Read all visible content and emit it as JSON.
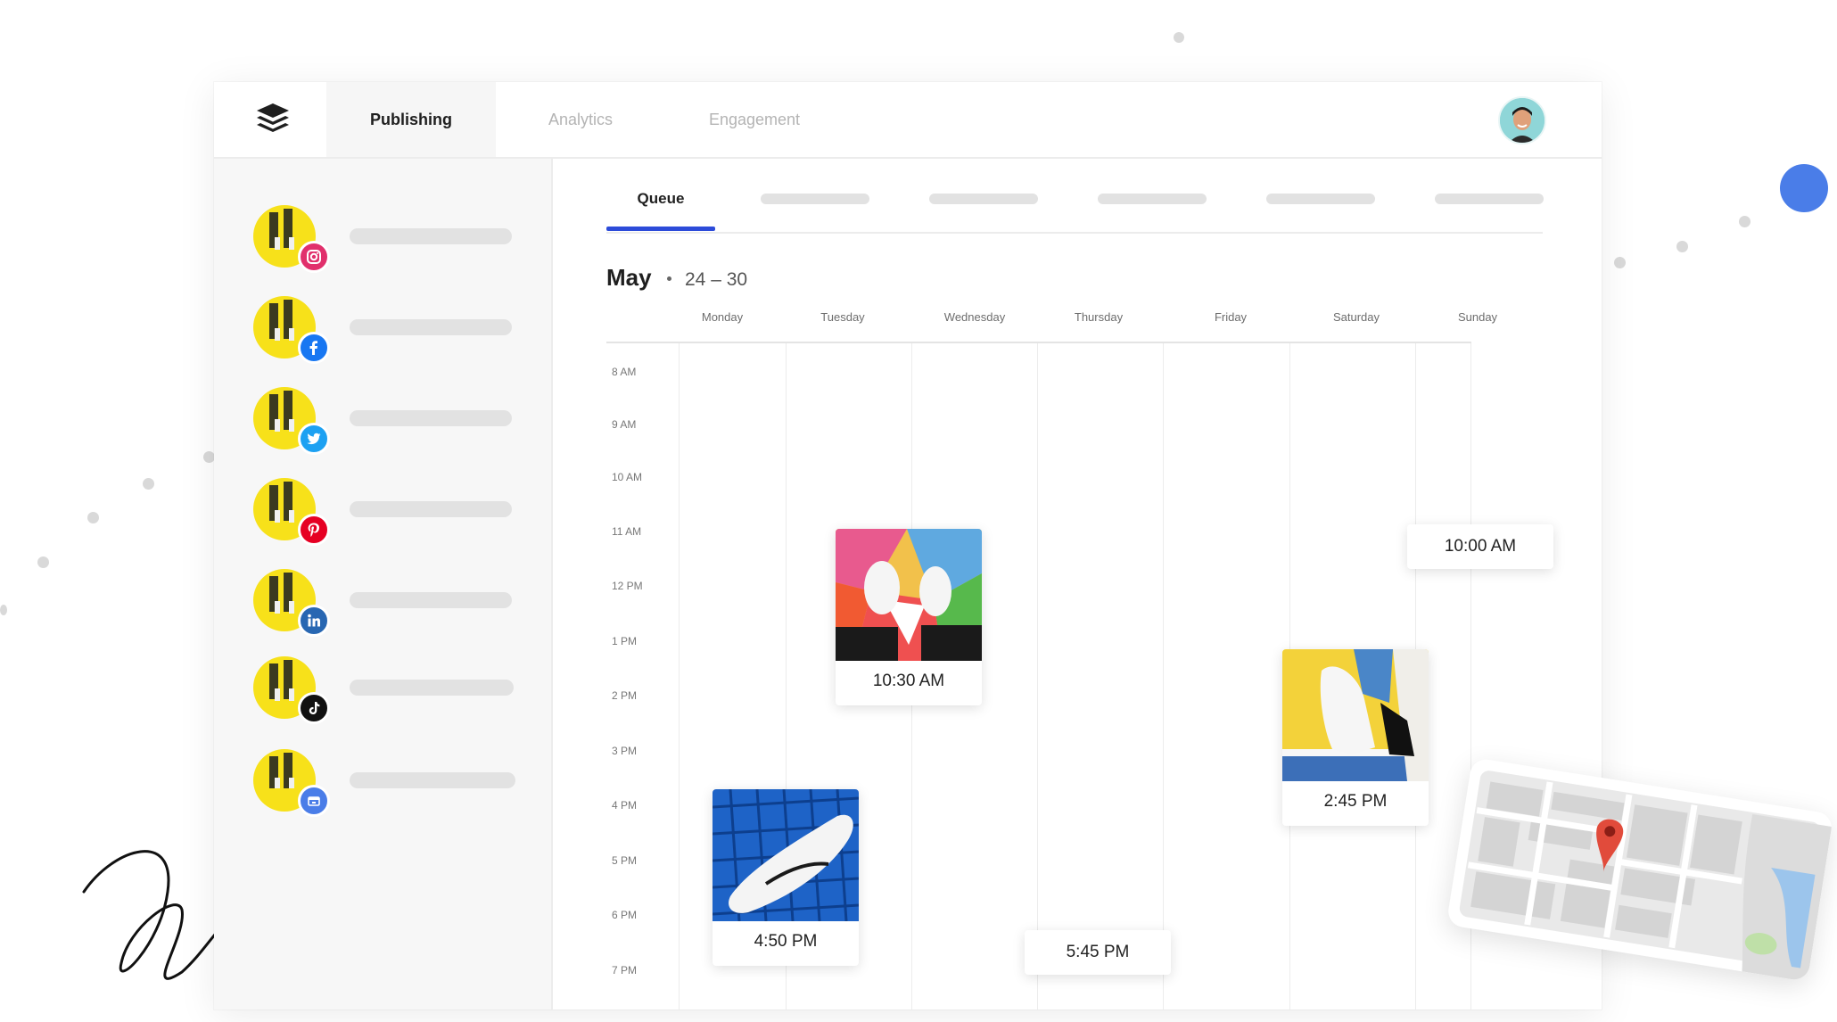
{
  "nav": {
    "tabs": [
      {
        "label": "Publishing",
        "active": true
      },
      {
        "label": "Analytics",
        "active": false
      },
      {
        "label": "Engagement",
        "active": false
      }
    ]
  },
  "sidebar": {
    "accounts": [
      {
        "network": "instagram",
        "badge_color": "#e1306c",
        "icon": "instagram-icon"
      },
      {
        "network": "facebook",
        "badge_color": "#1877f2",
        "icon": "facebook-icon"
      },
      {
        "network": "twitter",
        "badge_color": "#1da1f2",
        "icon": "twitter-icon"
      },
      {
        "network": "pinterest",
        "badge_color": "#e60023",
        "icon": "pinterest-icon"
      },
      {
        "network": "linkedin",
        "badge_color": "#2867b2",
        "icon": "linkedin-icon"
      },
      {
        "network": "tiktok",
        "badge_color": "#111111",
        "icon": "tiktok-icon"
      },
      {
        "network": "google-business",
        "badge_color": "#4a7de8",
        "icon": "google-business-icon"
      }
    ]
  },
  "queue": {
    "active_tab": "Queue",
    "month": "May",
    "range": "24 – 30"
  },
  "calendar": {
    "days": [
      "Monday",
      "Tuesday",
      "Wednesday",
      "Thursday",
      "Friday",
      "Saturday",
      "Sunday"
    ],
    "hours": [
      "8 AM",
      "9 AM",
      "10 AM",
      "11 AM",
      "12 PM",
      "1 PM",
      "2 PM",
      "3 PM",
      "4 PM",
      "5 PM",
      "6 PM",
      "7 PM"
    ],
    "posts": [
      {
        "time": "10:30 AM",
        "day": "Tuesday",
        "image": "colorful-sneakers-photo"
      },
      {
        "time": "4:50 PM",
        "day": "Monday",
        "image": "white-sneaker-blue-grid-photo"
      },
      {
        "time": "5:45 PM",
        "day": "Thursday"
      },
      {
        "time": "2:45 PM",
        "day": "Saturday",
        "image": "white-sneaker-yellow-wall-photo"
      },
      {
        "time": "10:00 AM",
        "day": "Sunday"
      }
    ]
  },
  "colors": {
    "accent": "#2c4bd9",
    "avatar_yellow": "#f7e11a",
    "deco_blue": "#4a7de8"
  }
}
